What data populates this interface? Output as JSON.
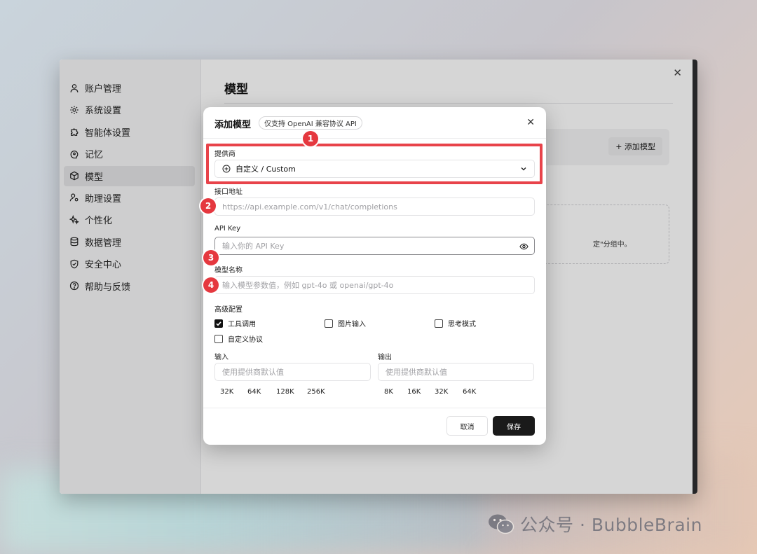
{
  "sidebar": {
    "items": [
      {
        "label": "账户管理",
        "icon": "user-icon"
      },
      {
        "label": "系统设置",
        "icon": "gear-icon"
      },
      {
        "label": "智能体设置",
        "icon": "puzzle-icon"
      },
      {
        "label": "记忆",
        "icon": "brain-icon"
      },
      {
        "label": "模型",
        "icon": "cube-icon",
        "active": true
      },
      {
        "label": "助理设置",
        "icon": "user-gear-icon"
      },
      {
        "label": "个性化",
        "icon": "sparkles-icon"
      },
      {
        "label": "数据管理",
        "icon": "database-icon"
      },
      {
        "label": "安全中心",
        "icon": "shield-icon"
      },
      {
        "label": "帮助与反馈",
        "icon": "help-icon"
      }
    ]
  },
  "content": {
    "title": "模型",
    "add_model_label": "+ 添加模型",
    "empty_hint_partial": "定\"分组中。"
  },
  "modal": {
    "title": "添加模型",
    "badge": "仅支持 OpenAI 兼容协议 API",
    "provider": {
      "label": "提供商",
      "value": "自定义 / Custom"
    },
    "endpoint": {
      "label": "接口地址",
      "placeholder": "https://api.example.com/v1/chat/completions"
    },
    "api_key": {
      "label": "API Key",
      "placeholder": "输入你的 API Key"
    },
    "model_name": {
      "label": "模型名称",
      "placeholder": "输入模型参数值，例如 gpt-4o 或 openai/gpt-4o"
    },
    "advanced": {
      "label": "高级配置",
      "options": [
        {
          "label": "工具调用",
          "checked": true
        },
        {
          "label": "图片输入",
          "checked": false
        },
        {
          "label": "思考模式",
          "checked": false
        },
        {
          "label": "自定义协议",
          "checked": false
        }
      ]
    },
    "input": {
      "label": "输入",
      "placeholder": "使用提供商默认值",
      "presets": [
        "32K",
        "64K",
        "128K",
        "256K"
      ]
    },
    "output": {
      "label": "输出",
      "placeholder": "使用提供商默认值",
      "presets": [
        "8K",
        "16K",
        "32K",
        "64K"
      ]
    },
    "cancel_label": "取消",
    "save_label": "保存"
  },
  "annotations": [
    "1",
    "2",
    "3",
    "4"
  ],
  "annotation_color": "#e5383f",
  "watermark": "公众号 · BubbleBrain"
}
